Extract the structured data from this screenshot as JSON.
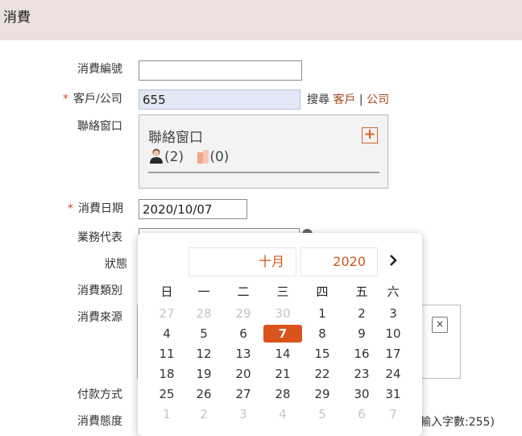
{
  "header": {
    "title": "消費"
  },
  "form": {
    "number_label": "消費編號",
    "number_value": "",
    "customer_label": "客戶/公司",
    "customer_value": "655",
    "search_label": "搜尋",
    "search_customer": "客戶",
    "search_separator": "|",
    "search_company": "公司",
    "contact_label": "聯絡窗口",
    "contact_title": "聯絡窗口",
    "contact_person_count": "(2)",
    "contact_company_count": "(0)",
    "date_label": "消費日期",
    "date_value": "2020/10/07",
    "rep_label": "業務代表",
    "status_label": "狀態",
    "type_label": "消費類別",
    "source_label": "消費來源",
    "payment_label": "付款方式",
    "attitude_label": "消費態度",
    "char_limit_note": "輸入字數:255)",
    "required_mark": "*",
    "remove_symbol": "×",
    "add_symbol": "+"
  },
  "calendar": {
    "month": "十月",
    "year": "2020",
    "next_symbol": "›",
    "weekdays": [
      "日",
      "一",
      "二",
      "三",
      "四",
      "五",
      "六"
    ],
    "weeks": [
      [
        {
          "d": "27",
          "o": true
        },
        {
          "d": "28",
          "o": true
        },
        {
          "d": "29",
          "o": true
        },
        {
          "d": "30",
          "o": true
        },
        {
          "d": "1"
        },
        {
          "d": "2"
        },
        {
          "d": "3"
        }
      ],
      [
        {
          "d": "4"
        },
        {
          "d": "5"
        },
        {
          "d": "6"
        },
        {
          "d": "7",
          "s": true
        },
        {
          "d": "8"
        },
        {
          "d": "9"
        },
        {
          "d": "10"
        }
      ],
      [
        {
          "d": "11"
        },
        {
          "d": "12"
        },
        {
          "d": "13"
        },
        {
          "d": "14"
        },
        {
          "d": "15"
        },
        {
          "d": "16"
        },
        {
          "d": "17"
        }
      ],
      [
        {
          "d": "18"
        },
        {
          "d": "19"
        },
        {
          "d": "20"
        },
        {
          "d": "21"
        },
        {
          "d": "22"
        },
        {
          "d": "23"
        },
        {
          "d": "24"
        }
      ],
      [
        {
          "d": "25"
        },
        {
          "d": "26"
        },
        {
          "d": "27"
        },
        {
          "d": "28"
        },
        {
          "d": "29"
        },
        {
          "d": "30"
        },
        {
          "d": "31"
        }
      ],
      [
        {
          "d": "1",
          "o": true
        },
        {
          "d": "2",
          "o": true
        },
        {
          "d": "3",
          "o": true
        },
        {
          "d": "4",
          "o": true
        },
        {
          "d": "5",
          "o": true
        },
        {
          "d": "6",
          "o": true
        },
        {
          "d": "7",
          "o": true
        }
      ]
    ]
  },
  "colors": {
    "accent": "#d9531c",
    "header_bg": "#ecdfdf",
    "link": "#a2461e"
  }
}
